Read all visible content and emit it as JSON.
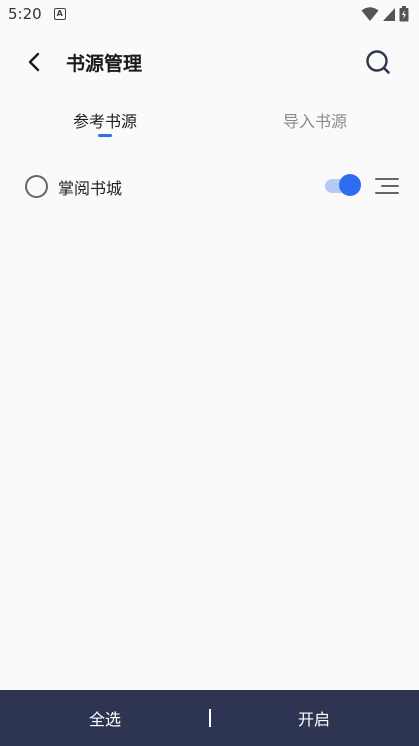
{
  "status_bar": {
    "time": "5:20",
    "app_icon_letter": "A"
  },
  "header": {
    "title": "书源管理"
  },
  "tabs": [
    {
      "label": "参考书源",
      "active": true
    },
    {
      "label": "导入书源",
      "active": false
    }
  ],
  "sources": [
    {
      "name": "掌阅书城",
      "selected": false,
      "enabled": true
    }
  ],
  "bottom_bar": {
    "select_all_label": "全选",
    "enable_label": "开启"
  },
  "colors": {
    "accent": "#2f6cf0",
    "bottom_bar_bg": "#2d3552"
  },
  "icons": {
    "back": "chevron-left-icon",
    "search": "search-icon",
    "drag": "drag-handle-icon"
  }
}
